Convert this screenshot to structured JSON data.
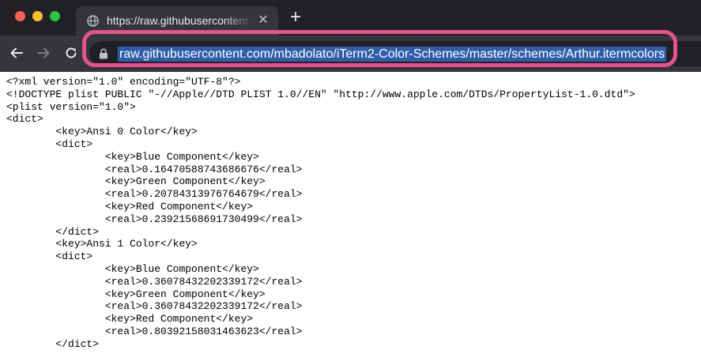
{
  "window": {
    "traffic_lights": {
      "close": "#ff5f57",
      "minimize": "#febc2e",
      "maximize": "#28c840"
    }
  },
  "tab": {
    "title": "https://raw.githubusercontent.c",
    "favicon": "globe-icon",
    "close_glyph": "✕"
  },
  "new_tab_glyph": "+",
  "address_bar": {
    "url": "raw.githubusercontent.com/mbadolato/iTerm2-Color-Schemes/master/schemes/Arthur.itermcolors",
    "security_icon": "lock-icon",
    "selection_color": "#2f5ea8"
  },
  "annotation": {
    "highlight_color": "#e8508e"
  },
  "content": {
    "lines": [
      "<?xml version=\"1.0\" encoding=\"UTF-8\"?>",
      "<!DOCTYPE plist PUBLIC \"-//Apple//DTD PLIST 1.0//EN\" \"http://www.apple.com/DTDs/PropertyList-1.0.dtd\">",
      "<plist version=\"1.0\">",
      "<dict>",
      "\t<key>Ansi 0 Color</key>",
      "\t<dict>",
      "\t\t<key>Blue Component</key>",
      "\t\t<real>0.16470588743686676</real>",
      "\t\t<key>Green Component</key>",
      "\t\t<real>0.20784313976764679</real>",
      "\t\t<key>Red Component</key>",
      "\t\t<real>0.23921568691730499</real>",
      "\t</dict>",
      "\t<key>Ansi 1 Color</key>",
      "\t<dict>",
      "\t\t<key>Blue Component</key>",
      "\t\t<real>0.36078432202339172</real>",
      "\t\t<key>Green Component</key>",
      "\t\t<real>0.36078432202339172</real>",
      "\t\t<key>Red Component</key>",
      "\t\t<real>0.80392158031463623</real>",
      "\t</dict>"
    ]
  }
}
